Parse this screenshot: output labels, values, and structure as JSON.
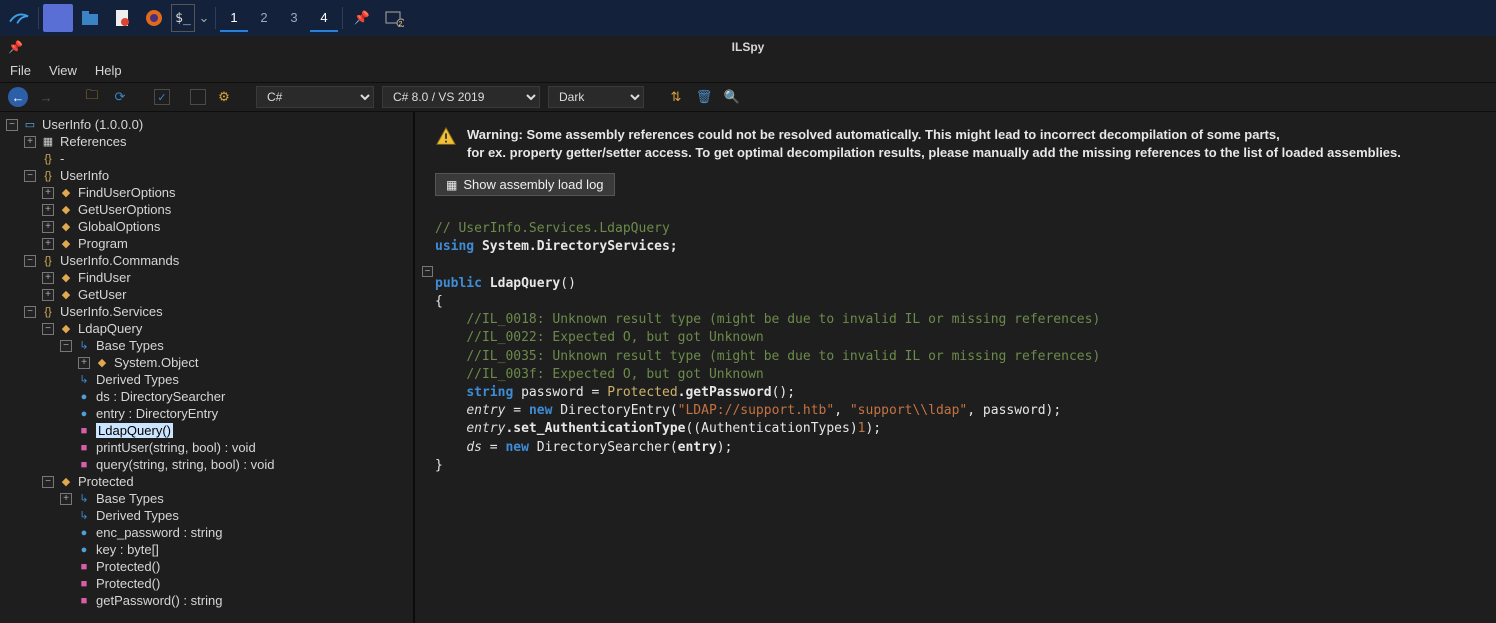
{
  "os_taskbar": {
    "workspaces": [
      "1",
      "2",
      "3",
      "4"
    ]
  },
  "app": {
    "title": "ILSpy",
    "menu": {
      "file": "File",
      "view": "View",
      "help": "Help"
    },
    "toolbar": {
      "lang": "C#",
      "version": "C# 8.0 / VS 2019",
      "theme": "Dark"
    }
  },
  "tree": {
    "root": "UserInfo (1.0.0.0)",
    "references": "References",
    "dash": "-",
    "ns_userinfo": "UserInfo",
    "finduseroptions": "FindUserOptions",
    "getuseroptions": "GetUserOptions",
    "globaloptions": "GlobalOptions",
    "program": "Program",
    "ns_commands": "UserInfo.Commands",
    "finduser": "FindUser",
    "getuser": "GetUser",
    "ns_services": "UserInfo.Services",
    "ldapquery": "LdapQuery",
    "basetypes": "Base Types",
    "system_object": "System.Object",
    "derivedtypes": "Derived Types",
    "ds_field": "ds : DirectorySearcher",
    "entry_field": "entry : DirectoryEntry",
    "ldapquery_ctor": "LdapQuery()",
    "printuser": "printUser(string, bool) : void",
    "query": "query(string, string, bool) : void",
    "protected": "Protected",
    "basetypes2": "Base Types",
    "derivedtypes2": "Derived Types",
    "enc_password": "enc_password : string",
    "key": "key : byte[]",
    "protected_ctor": "Protected()",
    "protected_cctor": "Protected()",
    "getpassword": "getPassword() : string"
  },
  "warning": {
    "line1": "Warning: Some assembly references could not be resolved automatically. This might lead to incorrect decompilation of some parts,",
    "line2": "for ex. property getter/setter access. To get optimal decompilation results, please manually add the missing references to the list of loaded assemblies."
  },
  "load_log": "Show assembly load log",
  "code": {
    "header_comment": "// UserInfo.Services.LdapQuery",
    "using_kw": "using",
    "using_ns": " System.DirectoryServices;",
    "public_kw": "public",
    "ctor_name": " LdapQuery",
    "parens": "()",
    "brace_open": "{",
    "il18": "//IL_0018: Unknown result type (might be due to invalid IL or missing references)",
    "il22": "//IL_0022: Expected O, but got Unknown",
    "il35": "//IL_0035: Unknown result type (might be due to invalid IL or missing references)",
    "il3f": "//IL_003f: Expected O, but got Unknown",
    "string_kw": "string",
    "password_decl": " password = ",
    "protected_type": "Protected",
    "getpassword_call": ".getPassword",
    "entry_ident": "entry",
    "eq_new": " = ",
    "new_kw": "new",
    "direntry": " DirectoryEntry(",
    "ldap_str": "\"LDAP://support.htb\"",
    "comma": ", ",
    "user_str": "\"support\\\\ldap\"",
    "pw_arg": ", password);",
    "set_auth": ".set_AuthenticationType",
    "auth_arg_open": "((AuthenticationTypes)",
    "one": "1",
    "close_paren_semi": ");",
    "ds_ident": "ds",
    "dirsearcher": " DirectorySearcher(",
    "entry_arg": "entry",
    "close_call": ");",
    "brace_close": "}"
  }
}
